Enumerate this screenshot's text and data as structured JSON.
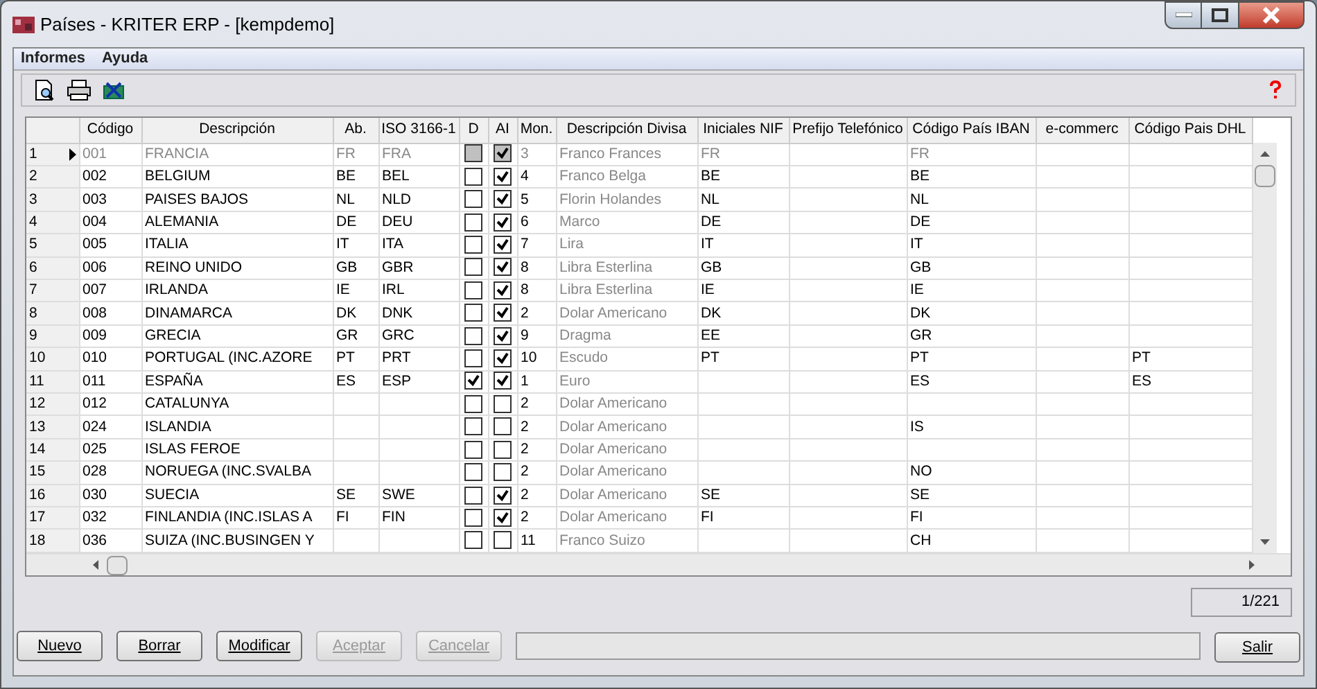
{
  "window": {
    "title": "Países - KRITER ERP - [kempdemo]"
  },
  "menu": [
    "Informes",
    "Ayuda"
  ],
  "table": {
    "columns": [
      "Código",
      "Descripción",
      "Ab.",
      "ISO 3166-1",
      "D",
      "AI",
      "Mon.",
      "Descripción Divisa",
      "Iniciales NIF",
      "Prefijo Telefónico",
      "Código País IBAN",
      "e-commerc",
      "Código Pais DHL"
    ],
    "rows": [
      {
        "number": "1",
        "current": true,
        "code": "001",
        "description": "FRANCIA",
        "ab": "FR",
        "iso": "FRA",
        "d": false,
        "ai": true,
        "currency": "3",
        "currency_name": "Franco Frances",
        "nif": "FR",
        "iban": "FR",
        "dhl": ""
      },
      {
        "number": "2",
        "current": false,
        "code": "002",
        "description": "BELGIUM",
        "ab": "BE",
        "iso": "BEL",
        "d": false,
        "ai": true,
        "currency": "4",
        "currency_name": "Franco Belga",
        "nif": "BE",
        "iban": "BE",
        "dhl": ""
      },
      {
        "number": "3",
        "current": false,
        "code": "003",
        "description": "PAISES BAJOS",
        "ab": "NL",
        "iso": "NLD",
        "d": false,
        "ai": true,
        "currency": "5",
        "currency_name": "Florin Holandes",
        "nif": "NL",
        "iban": "NL",
        "dhl": ""
      },
      {
        "number": "4",
        "current": false,
        "code": "004",
        "description": "ALEMANIA",
        "ab": "DE",
        "iso": "DEU",
        "d": false,
        "ai": true,
        "currency": "6",
        "currency_name": "Marco",
        "nif": "DE",
        "iban": "DE",
        "dhl": ""
      },
      {
        "number": "5",
        "current": false,
        "code": "005",
        "description": "ITALIA",
        "ab": "IT",
        "iso": "ITA",
        "d": false,
        "ai": true,
        "currency": "7",
        "currency_name": "Lira",
        "nif": "IT",
        "iban": "IT",
        "dhl": ""
      },
      {
        "number": "6",
        "current": false,
        "code": "006",
        "description": "REINO UNIDO",
        "ab": "GB",
        "iso": "GBR",
        "d": false,
        "ai": true,
        "currency": "8",
        "currency_name": "Libra Esterlina",
        "nif": "GB",
        "iban": "GB",
        "dhl": ""
      },
      {
        "number": "7",
        "current": false,
        "code": "007",
        "description": "IRLANDA",
        "ab": "IE",
        "iso": "IRL",
        "d": false,
        "ai": true,
        "currency": "8",
        "currency_name": "Libra Esterlina",
        "nif": "IE",
        "iban": "IE",
        "dhl": ""
      },
      {
        "number": "8",
        "current": false,
        "code": "008",
        "description": "DINAMARCA",
        "ab": "DK",
        "iso": "DNK",
        "d": false,
        "ai": true,
        "currency": "2",
        "currency_name": "Dolar Americano",
        "nif": "DK",
        "iban": "DK",
        "dhl": ""
      },
      {
        "number": "9",
        "current": false,
        "code": "009",
        "description": "GRECIA",
        "ab": "GR",
        "iso": "GRC",
        "d": false,
        "ai": true,
        "currency": "9",
        "currency_name": "Dragma",
        "nif": "EE",
        "iban": "GR",
        "dhl": ""
      },
      {
        "number": "10",
        "current": false,
        "code": "010",
        "description": "PORTUGAL (INC.AZORE",
        "ab": "PT",
        "iso": "PRT",
        "d": false,
        "ai": true,
        "currency": "10",
        "currency_name": "Escudo",
        "nif": "PT",
        "iban": "PT",
        "dhl": "PT"
      },
      {
        "number": "11",
        "current": false,
        "code": "011",
        "description": "ESPAÑA",
        "ab": "ES",
        "iso": "ESP",
        "d": true,
        "ai": true,
        "currency": "1",
        "currency_name": "Euro",
        "nif": "",
        "iban": "ES",
        "dhl": "ES"
      },
      {
        "number": "12",
        "current": false,
        "code": "012",
        "description": "CATALUNYA",
        "ab": "",
        "iso": "",
        "d": false,
        "ai": false,
        "currency": "2",
        "currency_name": "Dolar Americano",
        "nif": "",
        "iban": "",
        "dhl": ""
      },
      {
        "number": "13",
        "current": false,
        "code": "024",
        "description": "ISLANDIA",
        "ab": "",
        "iso": "",
        "d": false,
        "ai": false,
        "currency": "2",
        "currency_name": "Dolar Americano",
        "nif": "",
        "iban": "IS",
        "dhl": ""
      },
      {
        "number": "14",
        "current": false,
        "code": "025",
        "description": "ISLAS FEROE",
        "ab": "",
        "iso": "",
        "d": false,
        "ai": false,
        "currency": "2",
        "currency_name": "Dolar Americano",
        "nif": "",
        "iban": "",
        "dhl": ""
      },
      {
        "number": "15",
        "current": false,
        "code": "028",
        "description": "NORUEGA (INC.SVALBA",
        "ab": "",
        "iso": "",
        "d": false,
        "ai": false,
        "currency": "2",
        "currency_name": "Dolar Americano",
        "nif": "",
        "iban": "NO",
        "dhl": ""
      },
      {
        "number": "16",
        "current": false,
        "code": "030",
        "description": "SUECIA",
        "ab": "SE",
        "iso": "SWE",
        "d": false,
        "ai": true,
        "currency": "2",
        "currency_name": "Dolar Americano",
        "nif": "SE",
        "iban": "SE",
        "dhl": ""
      },
      {
        "number": "17",
        "current": false,
        "code": "032",
        "description": "FINLANDIA (INC.ISLAS A",
        "ab": "FI",
        "iso": "FIN",
        "d": false,
        "ai": true,
        "currency": "2",
        "currency_name": "Dolar Americano",
        "nif": "FI",
        "iban": "FI",
        "dhl": ""
      },
      {
        "number": "18",
        "current": false,
        "code": "036",
        "description": "SUIZA (INC.BUSINGEN Y",
        "ab": "",
        "iso": "",
        "d": false,
        "ai": false,
        "currency": "11",
        "currency_name": "Franco Suizo",
        "nif": "",
        "iban": "CH",
        "dhl": ""
      }
    ]
  },
  "record_counter": "1/221",
  "buttons": [
    {
      "label": "Nuevo",
      "disabled": false
    },
    {
      "label": "Borrar",
      "disabled": false
    },
    {
      "label": "Modificar",
      "disabled": false
    },
    {
      "label": "Aceptar",
      "disabled": true
    },
    {
      "label": "Cancelar",
      "disabled": true
    }
  ],
  "exit_button": {
    "label": "Salir",
    "disabled": false
  }
}
